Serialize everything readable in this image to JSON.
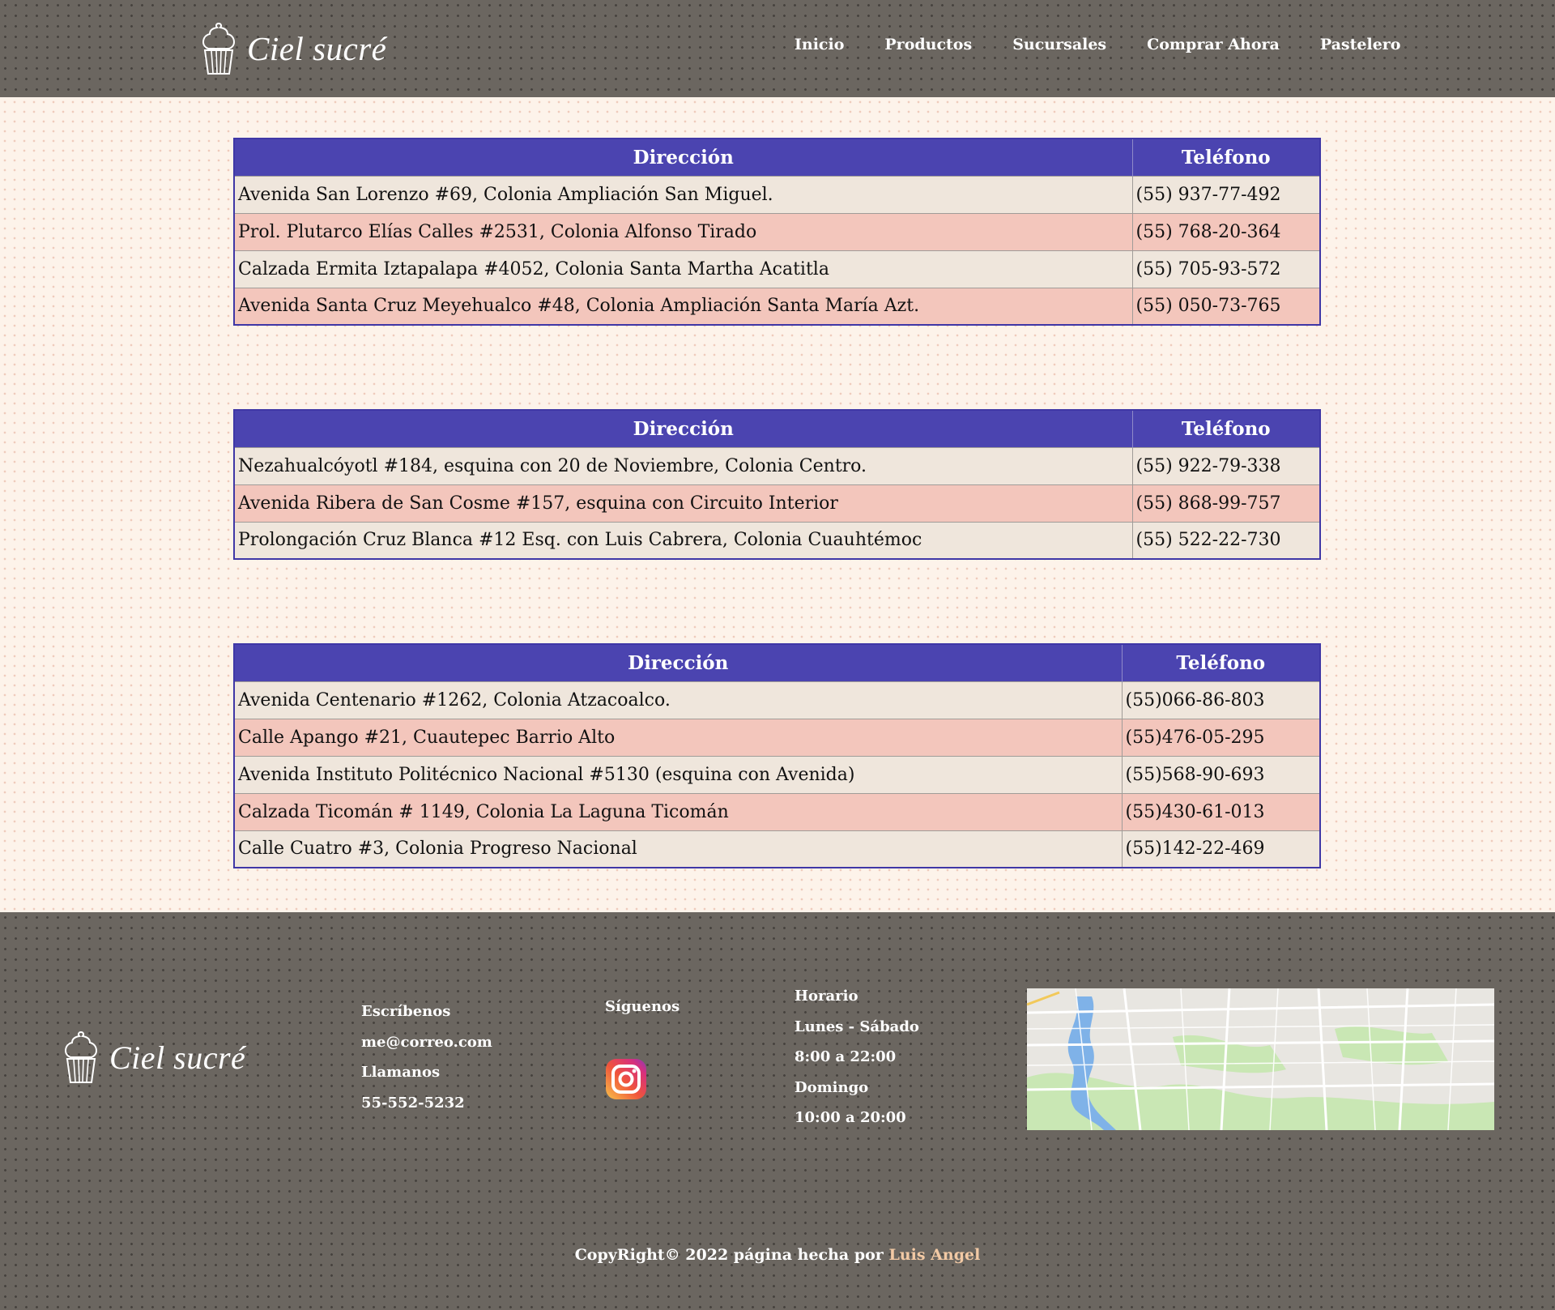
{
  "header": {
    "brand": "Ciel sucré",
    "nav": [
      "Inicio",
      "Productos",
      "Sucursales",
      "Comprar Ahora",
      "Pastelero"
    ]
  },
  "tables": [
    {
      "headers": [
        "Dirección",
        "Teléfono"
      ],
      "rows": [
        [
          "Avenida San Lorenzo #69, Colonia Ampliación San Miguel.",
          "(55) 937-77-492"
        ],
        [
          "Prol. Plutarco Elías Calles #2531, Colonia Alfonso Tirado",
          "(55) 768-20-364"
        ],
        [
          "Calzada Ermita Iztapalapa #4052, Colonia Santa Martha Acatitla",
          "(55) 705-93-572"
        ],
        [
          "Avenida Santa Cruz Meyehualco #48, Colonia Ampliación Santa María Azt.",
          "(55) 050-73-765"
        ]
      ]
    },
    {
      "headers": [
        "Dirección",
        "Teléfono"
      ],
      "rows": [
        [
          "Nezahualcóyotl #184, esquina con 20 de Noviembre, Colonia Centro.",
          "(55) 922-79-338"
        ],
        [
          "Avenida Ribera de San Cosme #157, esquina con Circuito Interior",
          "(55) 868-99-757"
        ],
        [
          "Prolongación Cruz Blanca #12 Esq. con Luis Cabrera, Colonia Cuauhtémoc",
          "(55) 522-22-730"
        ]
      ]
    },
    {
      "headers": [
        "Dirección",
        "Teléfono"
      ],
      "rows": [
        [
          "Avenida Centenario #1262, Colonia Atzacoalco.",
          "(55)066-86-803"
        ],
        [
          "Calle Apango #21, Cuautepec Barrio Alto",
          "(55)476-05-295"
        ],
        [
          "Avenida Instituto Politécnico Nacional #5130 (esquina con Avenida)",
          "(55)568-90-693"
        ],
        [
          "Calzada Ticomán # 1149, Colonia La Laguna Ticomán",
          "(55)430-61-013"
        ],
        [
          "Calle Cuatro #3, Colonia Progreso Nacional",
          "(55)142-22-469"
        ]
      ]
    }
  ],
  "footer": {
    "brand": "Ciel sucré",
    "contact": [
      "Escríbenos",
      "me@correo.com",
      "Llamanos",
      "55-552-5232"
    ],
    "social_title": "Síguenos",
    "social_icon": "instagram-icon",
    "hours": [
      "Horario",
      "Lunes - Sábado",
      "8:00 a 22:00",
      "Domingo",
      "10:00 a 20:00"
    ],
    "copyright_prefix": "CopyRight© 2022 página hecha por ",
    "author": "Luis Angel"
  },
  "colors": {
    "header_bg": "#6b6660",
    "table_header": "#4b44b0",
    "row_light": "#efe6dc",
    "row_pink": "#f3c6bc",
    "author_link": "#f2c9a4"
  }
}
